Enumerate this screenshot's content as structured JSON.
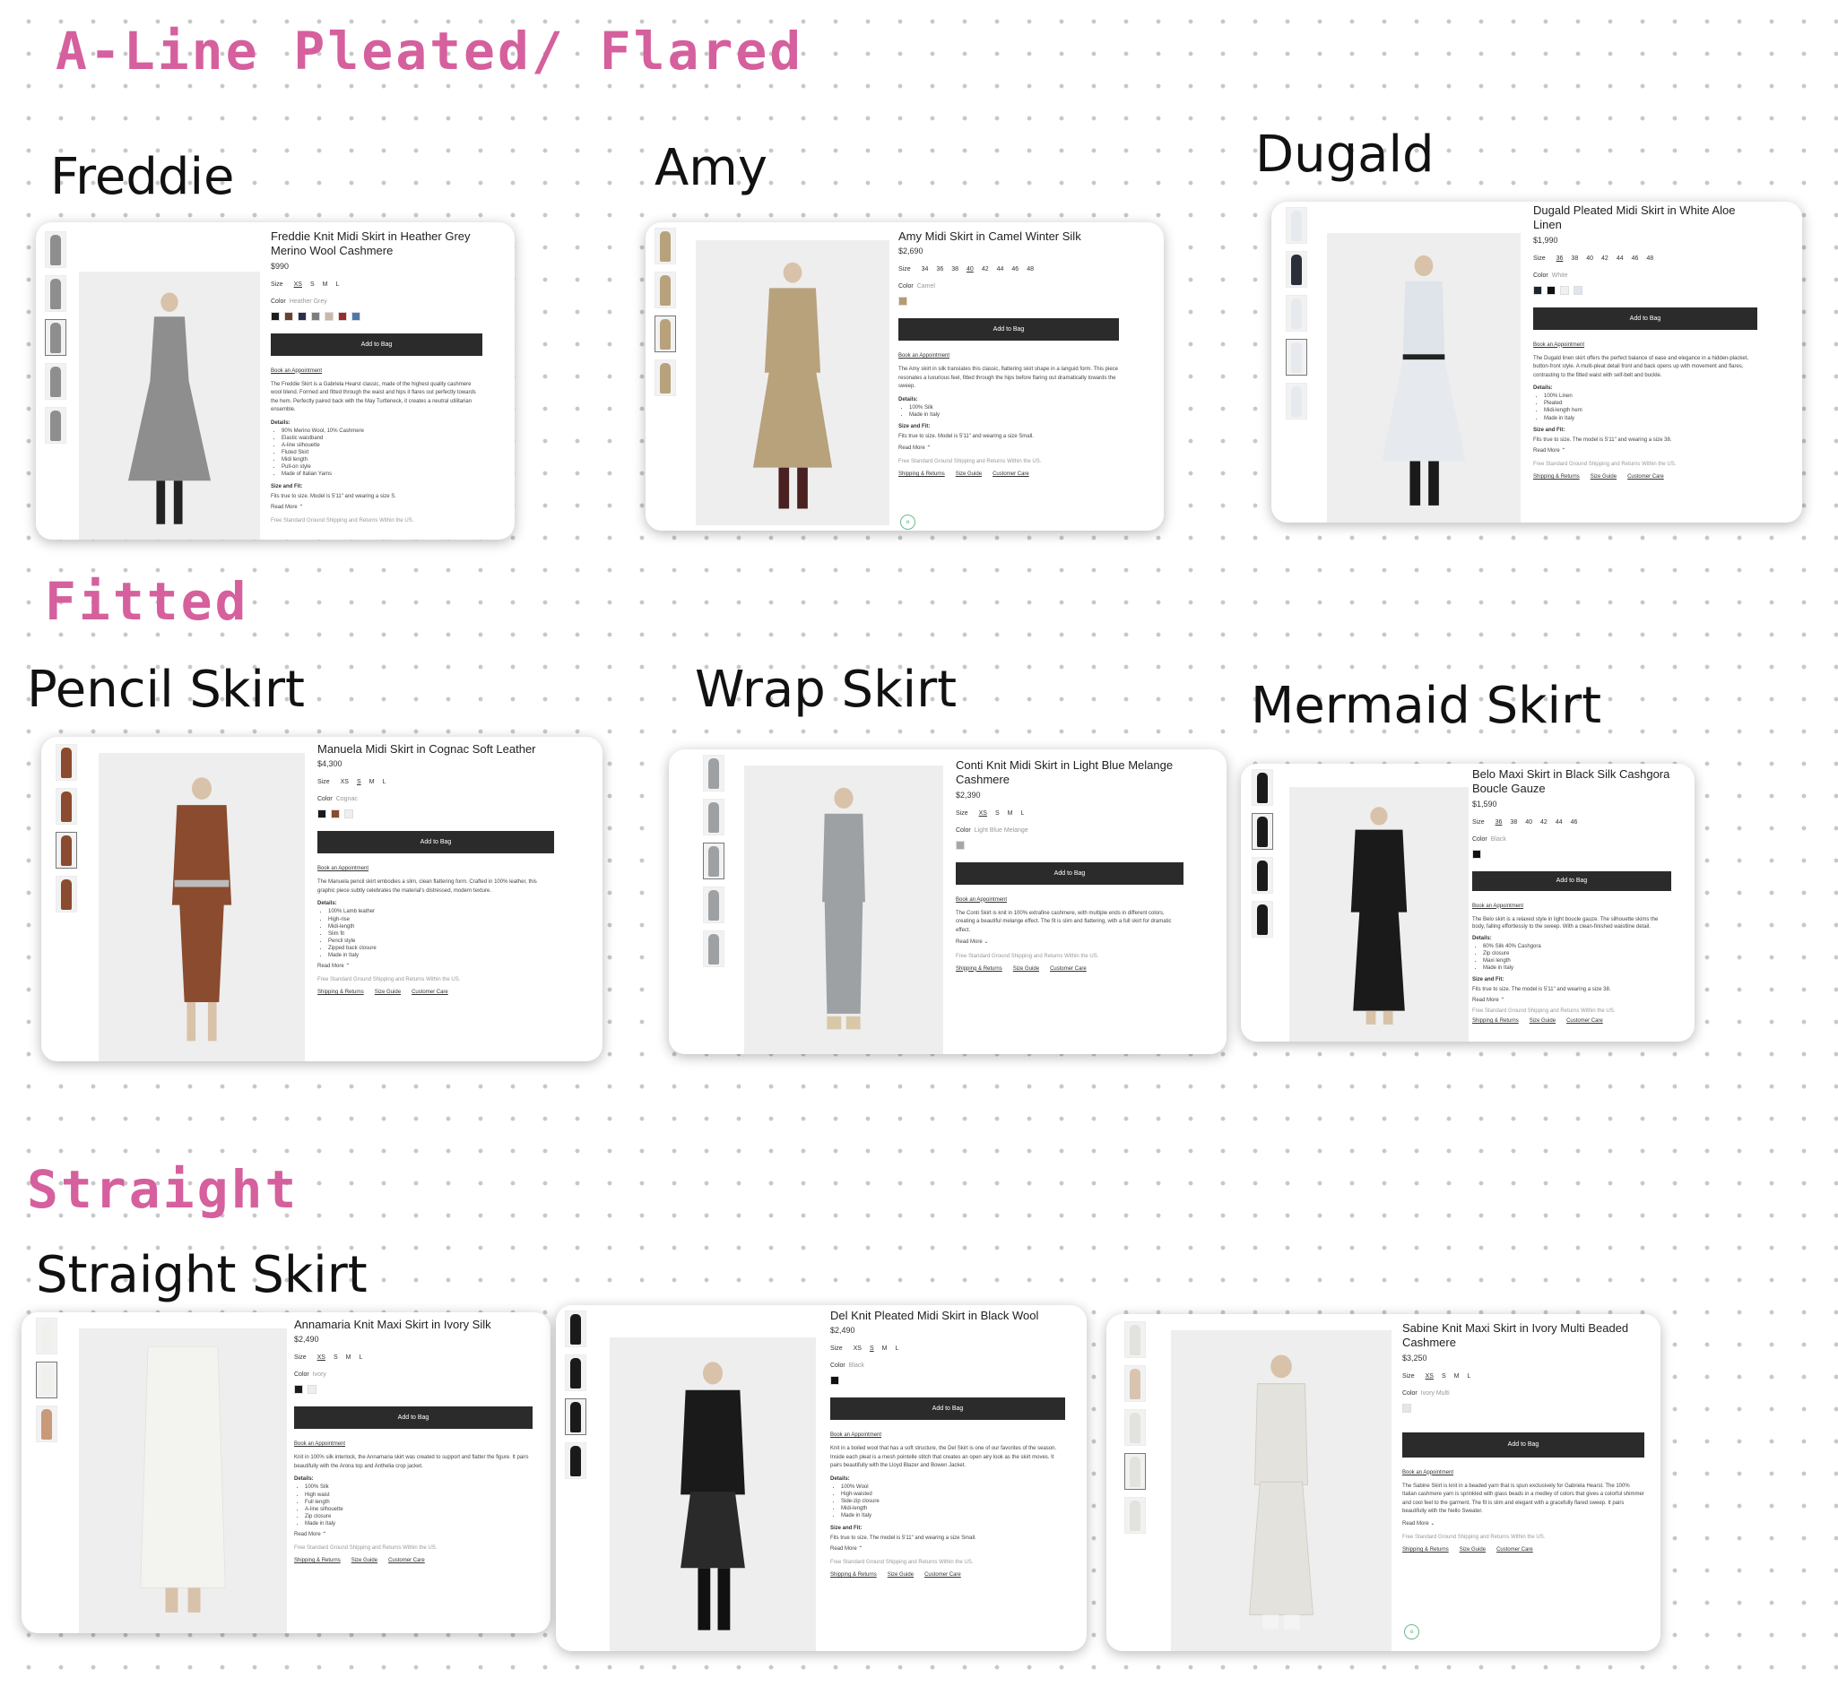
{
  "sections": {
    "aline": "A-Line Pleated/ Flared",
    "fitted": "Fitted",
    "straight": "Straight"
  },
  "labels": {
    "freddie": "Freddie",
    "amy": "Amy",
    "dugald": "Dugald",
    "pencil": "Pencil Skirt",
    "wrap": "Wrap Skirt",
    "mermaid": "Mermaid Skirt",
    "straight": "Straight Skirt"
  },
  "common": {
    "add_to_bag": "Add to Bag",
    "book_appt": "Book an Appointment",
    "details": "Details:",
    "size_fit": "Size and Fit:",
    "read_more": "Read More",
    "free_ship": "Free Standard Ground Shipping and Returns Within the US.",
    "links": [
      "Shipping & Returns",
      "Size Guide",
      "Customer Care"
    ],
    "size_label": "Size",
    "color_label": "Color"
  },
  "products": {
    "freddie": {
      "name": "Freddie Knit Midi Skirt in Heather Grey Merino Wool Cashmere",
      "price": "$990",
      "sizes": [
        "XS",
        "S",
        "M",
        "L"
      ],
      "color_name": "Heather Grey",
      "swatches": [
        "#1c1c1c",
        "#6a4030",
        "#26304a",
        "#7d7d7d",
        "#c8b8a8",
        "#9b2a2a",
        "#4f78a8"
      ],
      "description": "The Freddie Skirt is a Gabriela Hearst classic, made of the highest quality cashmere wool blend. Formed and fitted through the waist and hips it flares out perfectly towards the hem. Perfectly paired back with the May Turtleneck, it creates a neutral utilitarian ensemble.",
      "details": [
        "90% Merino Wool, 10% Cashmere",
        "Elastic waistband",
        "A-line silhouette",
        "Fluted Skirt",
        "Midi length",
        "Pull-on style",
        "Made of Italian Yarns"
      ],
      "fit": "Fits true to size. Model is 5'11\" and wearing a size S.",
      "garment": "#8e8e8e"
    },
    "amy": {
      "name": "Amy Midi Skirt in Camel Winter Silk",
      "price": "$2,690",
      "sizes": [
        "34",
        "36",
        "38",
        "40",
        "42",
        "44",
        "46",
        "48"
      ],
      "color_name": "Camel",
      "swatches": [
        "#b89a70"
      ],
      "description": "The Amy skirt in silk translates this classic, flattering skirt shape in a languid form. This piece resonates a luxurious feel, fitted through the hips before flaring out dramatically towards the sweep.",
      "details": [
        "100% Silk",
        "Made in Italy"
      ],
      "fit": "Fits true to size. Model is 5'11\" and wearing a size Small.",
      "garment": "#b8a27c"
    },
    "dugald": {
      "name": "Dugald Pleated Midi Skirt in White Aloe Linen",
      "price": "$1,990",
      "sizes": [
        "36",
        "38",
        "40",
        "42",
        "44",
        "46",
        "48"
      ],
      "color_name": "White",
      "swatches": [
        "#1e2430",
        "#111111",
        "#f0f0f0",
        "#dfe6f0"
      ],
      "description": "The Dugald linen skirt offers the perfect balance of ease and elegance in a hidden-placket, button-front style. A multi-pleat detail front and back opens up with movement and flares, contrasting to the fitted waist with self-belt and buckle.",
      "details": [
        "100% Linen",
        "Pleated",
        "Midi-length hem",
        "Made in Italy"
      ],
      "fit": "Fits true to size. The model is 5'11\" and wearing a size 38.",
      "garment": "#e6e9ee"
    },
    "manuela": {
      "name": "Manuela Midi Skirt in Cognac Soft Leather",
      "price": "$4,300",
      "sizes": [
        "XS",
        "S",
        "M",
        "L"
      ],
      "color_name": "Cognac",
      "swatches": [
        "#1a1a1a",
        "#8a4b2e",
        "#eeeeee"
      ],
      "description": "The Manuela pencil skirt embodies a slim, clean flattering form. Crafted in 100% leather, this graphic piece subtly celebrates the material's distressed, modern texture.",
      "details": [
        "100% Lamb leather",
        "High-rise",
        "Midi-length",
        "Slim fit",
        "Pencil style",
        "Zipped back closure",
        "Made in Italy"
      ],
      "garment": "#8a4b2e"
    },
    "conti": {
      "name": "Conti Knit Midi Skirt in Light Blue Melange Cashmere",
      "price": "$2,390",
      "sizes": [
        "XS",
        "S",
        "M",
        "L"
      ],
      "color_name": "Light Blue Melange",
      "swatches": [
        "#a5a8ab"
      ],
      "description": "The Conti Skirt is knit in 100% extrafine cashmere, with multiple ends in different colors, creating a beautiful melange effect. The fit is slim and flattering, with a full skirt for dramatic effect.",
      "garment": "#9ea1a4"
    },
    "belo": {
      "name": "Belo Maxi Skirt in Black Silk Cashgora Boucle Gauze",
      "price": "$1,590",
      "sizes": [
        "36",
        "38",
        "40",
        "42",
        "44",
        "46"
      ],
      "color_name": "Black",
      "swatches": [
        "#111111"
      ],
      "description": "The Belo skirt is a relaxed style in light boucle gauze. The silhouette skims the body, falling effortlessly to the sweep. With a clean-finished waistline detail.",
      "details": [
        "60% Silk 40% Cashgora",
        "Zip closure",
        "Maxi length",
        "Made in Italy"
      ],
      "fit": "Fits true to size. The model is 5'11\" and wearing a size 38.",
      "garment": "#1a1a1a"
    },
    "annamaria": {
      "name": "Annamaria Knit Maxi Skirt in Ivory Silk",
      "price": "$2,490",
      "sizes": [
        "XS",
        "S",
        "M",
        "L"
      ],
      "color_name": "Ivory",
      "swatches": [
        "#1a1a1a",
        "#eeeeea"
      ],
      "description": "Knit in 100% silk interlock, the Annamaria skirt was created to support and flatter the figure. It pairs beautifully with the Arona top and Anthelia crop jacket.",
      "details": [
        "100% Silk",
        "High waist",
        "Full length",
        "A-line silhouette",
        "Zip closure",
        "Made in Italy"
      ],
      "garment": "#f3f3ef"
    },
    "del": {
      "name": "Del Knit Pleated Midi Skirt in Black Wool",
      "price": "$2,490",
      "sizes": [
        "XS",
        "S",
        "M",
        "L"
      ],
      "color_name": "Black",
      "swatches": [
        "#111111"
      ],
      "description": "Knit in a boiled wool that has a soft structure, the Del Skirt is one of our favorites of the season. Inside each pleat is a mesh pointelle stitch that creates an open airy look as the skirt moves. It pairs beautifully with the Lloyd Blazer and Bowen Jacket.",
      "details": [
        "100% Wool",
        "High-waisted",
        "Side-zip closure",
        "Midi-length",
        "Made in Italy"
      ],
      "fit": "Fits true to size. The model is 5'11\" and wearing a size Small.",
      "garment": "#1a1a1a"
    },
    "sabine": {
      "name": "Sabine Knit Maxi Skirt in Ivory Multi Beaded Cashmere",
      "price": "$3,250",
      "sizes": [
        "XS",
        "S",
        "M",
        "L"
      ],
      "color_name": "Ivory Multi",
      "swatches": [
        "#e6e6e2"
      ],
      "description": "The Sabine Skirt is knit in a beaded yarn that is spun exclusively for Gabriela Hearst. The 100% Italian cashmere yarn is sprinkled with glass beads in a medley of colors that gives a colorful shimmer and cool feel to the garment. The fit is slim and elegant with a gracefully flared sweep. It pairs beautifully with the Nello Sweater.",
      "garment": "#e4e2dc"
    }
  }
}
